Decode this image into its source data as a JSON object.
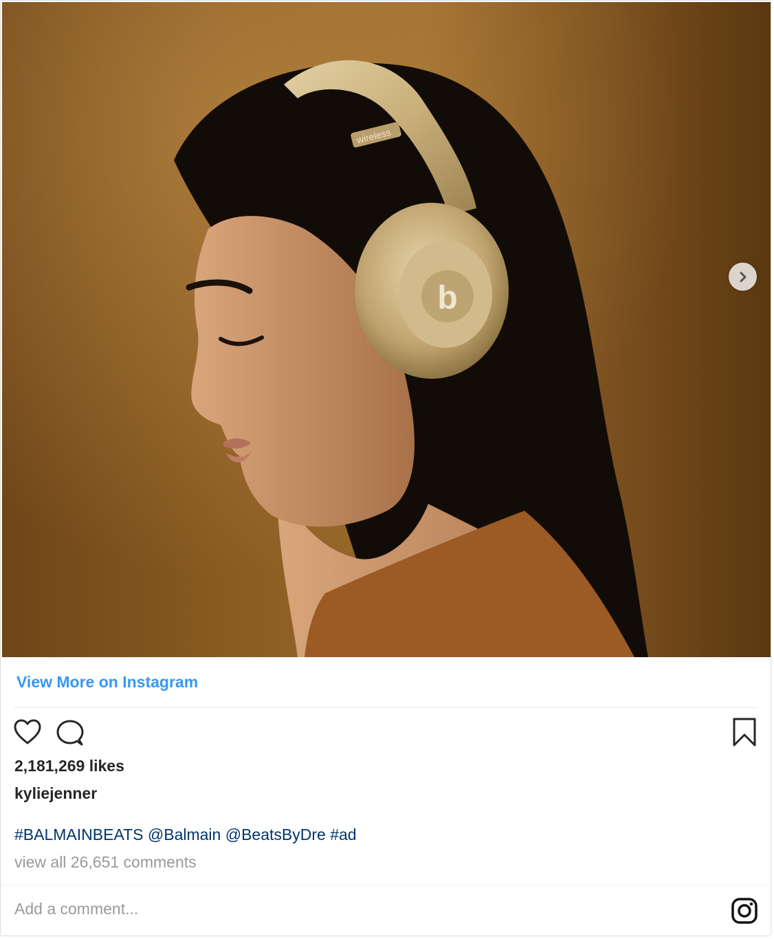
{
  "post": {
    "image_alt": "Kylie Jenner in profile wearing gold Beats wireless headphones",
    "headphone_band_text": "wireless",
    "headphone_logo_text": "b"
  },
  "view_more_label": "View More on Instagram",
  "likes_text": "2,181,269 likes",
  "username": "kyliejenner",
  "caption": {
    "tag1": "#BALMAINBEATS",
    "mention1": "@Balmain",
    "mention2": "@BeatsByDre",
    "tag2": "#ad"
  },
  "comments_link": "view all 26,651 comments",
  "add_comment_placeholder": "Add a comment...",
  "icons": {
    "like": "heart-icon",
    "comment": "comment-bubble-icon",
    "save": "bookmark-icon",
    "next": "chevron-right-icon",
    "brand": "instagram-icon"
  },
  "colors": {
    "link_blue": "#3897f0",
    "caption_blue": "#003569",
    "muted_gray": "#999999",
    "text_dark": "#262626"
  }
}
